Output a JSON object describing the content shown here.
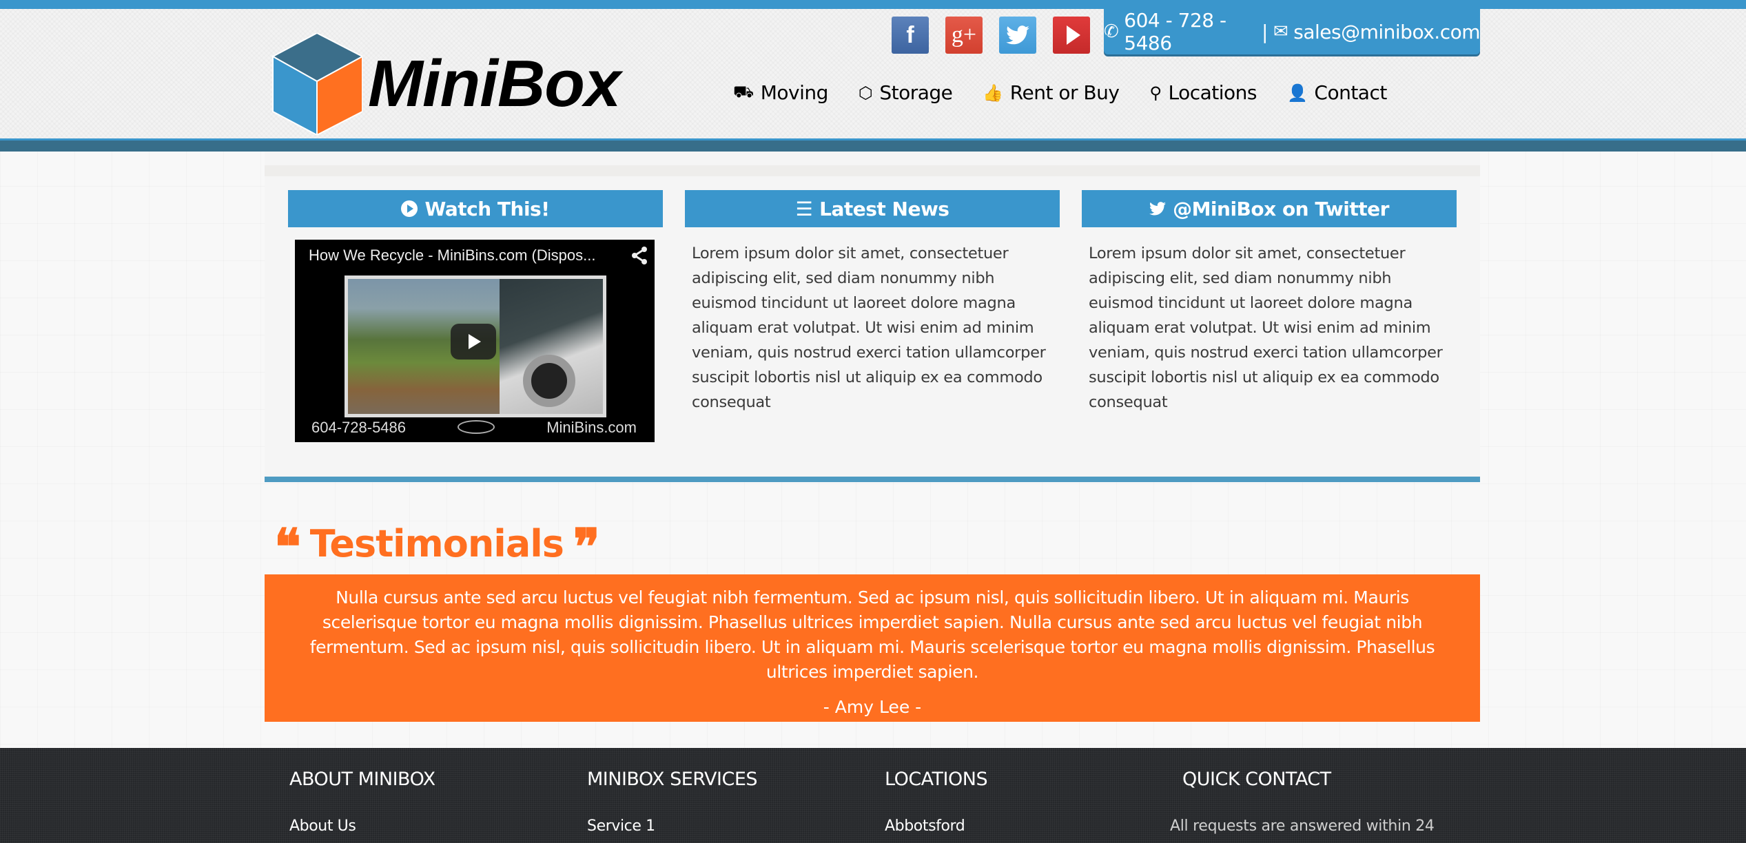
{
  "brand": {
    "name": "MiniBox",
    "colors": {
      "blue": "#3a96cc",
      "dark_blue": "#376e8a",
      "orange": "#ff6f20",
      "cube_top": "#3b6e8a"
    }
  },
  "header": {
    "socials": [
      {
        "name": "facebook",
        "glyph": "f"
      },
      {
        "name": "google-plus",
        "glyph": "g+"
      },
      {
        "name": "twitter",
        "glyph": "🐦"
      },
      {
        "name": "youtube",
        "glyph": "▶"
      }
    ],
    "contact": {
      "phone": "604 - 728 - 5486",
      "separator": "|",
      "email": "sales@minibox.com"
    },
    "nav": [
      {
        "label": "Moving",
        "icon": "truck-icon",
        "glyph": "🚚"
      },
      {
        "label": "Storage",
        "icon": "box-icon",
        "glyph": "📦"
      },
      {
        "label": "Rent or Buy",
        "icon": "thumbs-up-icon",
        "glyph": "👍"
      },
      {
        "label": "Locations",
        "icon": "map-marker-icon",
        "glyph": "📍"
      },
      {
        "label": "Contact",
        "icon": "user-icon",
        "glyph": "👤"
      }
    ]
  },
  "columns": {
    "watch": {
      "title": "Watch This!",
      "video": {
        "title": "How We Recycle - MiniBins.com (Dispos...",
        "overlay_phone": "604-728-5486",
        "overlay_site": "MiniBins.com"
      }
    },
    "news": {
      "title": "Latest News",
      "text": "Lorem ipsum dolor sit amet, consectetuer adipiscing elit, sed diam nonummy nibh euismod tincidunt ut laoreet dolore magna aliquam erat volutpat. Ut wisi enim ad minim veniam, quis nostrud exerci tation ullamcorper suscipit lobortis nisl ut aliquip ex ea commodo consequat"
    },
    "twitter": {
      "title": "@MiniBox on Twitter",
      "text": "Lorem ipsum dolor sit amet, consectetuer adipiscing elit, sed diam nonummy nibh euismod tincidunt ut laoreet dolore magna aliquam erat volutpat. Ut wisi enim ad minim veniam, quis nostrud exerci tation ullamcorper suscipit lobortis nisl ut aliquip ex ea commodo consequat"
    }
  },
  "testimonials": {
    "title": "Testimonials",
    "open_quote": "❝",
    "close_quote": "❞",
    "quote": "Nulla cursus ante sed arcu luctus vel feugiat nibh fermentum. Sed ac ipsum nisl, quis sollicitudin libero. Ut in aliquam mi. Mauris scelerisque tortor eu magna mollis dignissim. Phasellus ultrices imperdiet sapien. Nulla cursus ante sed arcu luctus vel feugiat nibh fermentum. Sed ac ipsum nisl, quis sollicitudin libero. Ut in aliquam mi. Mauris scelerisque tortor eu magna mollis dignissim. Phasellus ultrices imperdiet sapien.",
    "author": "- Amy Lee -"
  },
  "footer": {
    "about": {
      "title": "ABOUT MINIBOX",
      "links": [
        "About Us"
      ]
    },
    "services": {
      "title": "MINIBOX SERVICES",
      "links": [
        "Service 1"
      ]
    },
    "locations": {
      "title": "LOCATIONS",
      "links": [
        "Abbotsford"
      ]
    },
    "quick_contact": {
      "title": "QUICK CONTACT",
      "note": "All requests are answered within 24"
    }
  }
}
